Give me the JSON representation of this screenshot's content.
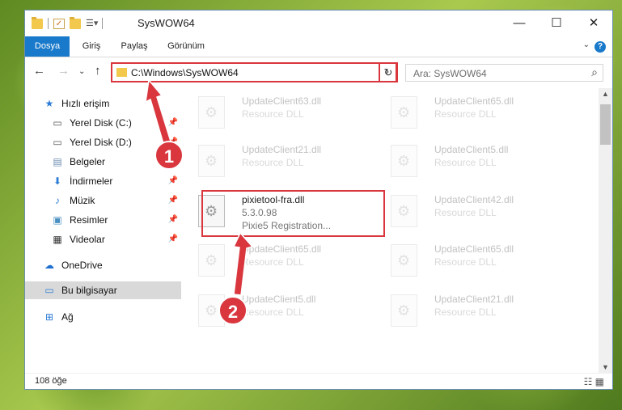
{
  "window": {
    "title": "SysWOW64",
    "controls": {
      "minimize": "—",
      "maximize": "☐",
      "close": "✕"
    }
  },
  "ribbon": {
    "tabs": [
      "Dosya",
      "Giriş",
      "Paylaş",
      "Görünüm"
    ],
    "help": "?"
  },
  "navigation": {
    "address": "C:\\Windows\\SysWOW64",
    "search_placeholder": "Ara: SysWOW64"
  },
  "sidebar": {
    "items": [
      {
        "label": "Hızlı erişim",
        "icon": "star-icon",
        "pinned": false
      },
      {
        "label": "Yerel Disk (C:)",
        "icon": "drive-icon",
        "pinned": true
      },
      {
        "label": "Yerel Disk (D:)",
        "icon": "drive-icon",
        "pinned": true
      },
      {
        "label": "Belgeler",
        "icon": "document-icon",
        "pinned": true
      },
      {
        "label": "İndirmeler",
        "icon": "download-icon",
        "pinned": true
      },
      {
        "label": "Müzik",
        "icon": "music-icon",
        "pinned": true
      },
      {
        "label": "Resimler",
        "icon": "pictures-icon",
        "pinned": true
      },
      {
        "label": "Videolar",
        "icon": "video-icon",
        "pinned": true
      },
      {
        "label": "OneDrive",
        "icon": "cloud-icon",
        "pinned": false
      },
      {
        "label": "Bu bilgisayar",
        "icon": "computer-icon",
        "pinned": false,
        "selected": true
      },
      {
        "label": "Ağ",
        "icon": "network-icon",
        "pinned": false
      }
    ]
  },
  "files": {
    "left": [
      {
        "name": "UpdateClient63.dll",
        "desc": "Resource DLL"
      },
      {
        "name": "UpdateClient21.dll",
        "desc": "Resource DLL"
      },
      {
        "name": "pixietool-fra.dll",
        "desc": "5.3.0.98",
        "desc2": "Pixie5 Registration..."
      },
      {
        "name": "UpdateClient65.dll",
        "desc": "Resource DLL"
      },
      {
        "name": "UpdateClient5.dll",
        "desc": "Resource DLL"
      }
    ],
    "right": [
      {
        "name": "UpdateClient65.dll",
        "desc": "Resource DLL"
      },
      {
        "name": "UpdateClient5.dll",
        "desc": "Resource DLL"
      },
      {
        "name": "UpdateClient42.dll",
        "desc": "Resource DLL"
      },
      {
        "name": "UpdateClient65.dll",
        "desc": "Resource DLL"
      },
      {
        "name": "UpdateClient21.dll",
        "desc": "Resource DLL"
      }
    ]
  },
  "status": {
    "count": "108 öğe"
  },
  "annotations": {
    "step1": "1",
    "step2": "2",
    "color": "#d9363e"
  }
}
